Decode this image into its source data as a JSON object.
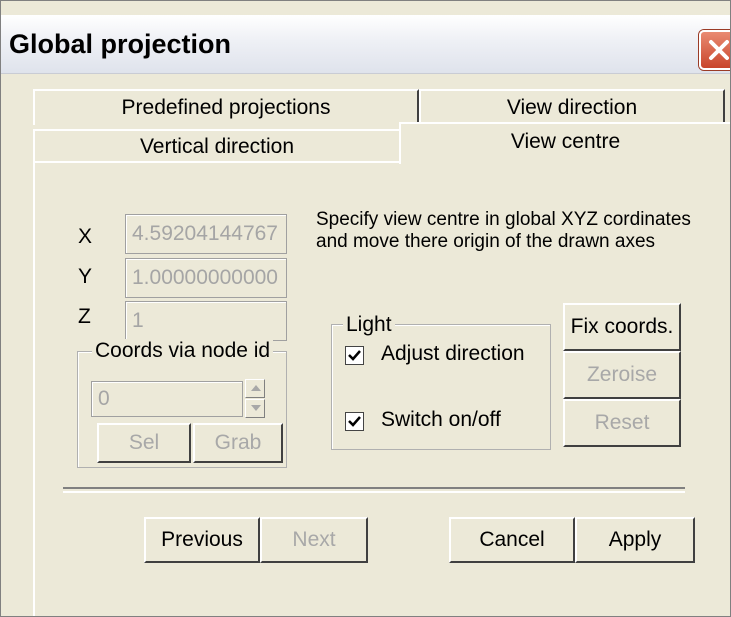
{
  "window": {
    "title": "Global projection"
  },
  "tabs": {
    "back": [
      {
        "label": "Predefined projections"
      },
      {
        "label": "View direction"
      }
    ],
    "front": [
      {
        "label": "Vertical direction"
      },
      {
        "label": "View centre"
      }
    ]
  },
  "coords": {
    "x_label": "X",
    "x_value": "4.59204144767",
    "y_label": "Y",
    "y_value": "1.00000000000",
    "z_label": "Z",
    "z_value": "1"
  },
  "description": "Specify view centre in global XYZ cordinates and move there origin of the drawn axes",
  "node_group": {
    "legend": "Coords via node id",
    "value": "0",
    "sel_label": "Sel",
    "grab_label": "Grab"
  },
  "light_group": {
    "legend": "Light",
    "adjust_label": "Adjust direction",
    "adjust_checked": true,
    "switch_label": "Switch on/off",
    "switch_checked": true
  },
  "side_buttons": {
    "fix_label": "Fix coords.",
    "zeroise_label": "Zeroise",
    "reset_label": "Reset"
  },
  "bottom_buttons": {
    "previous_label": "Previous",
    "next_label": "Next",
    "cancel_label": "Cancel",
    "apply_label": "Apply"
  }
}
